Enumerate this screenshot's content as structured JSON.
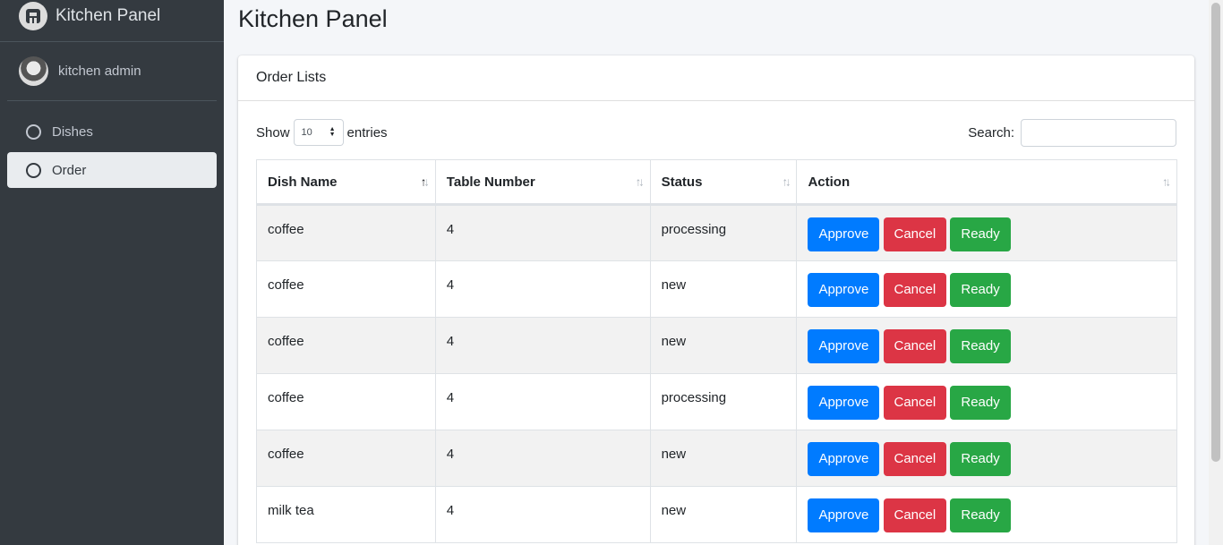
{
  "brand": {
    "title": "Kitchen Panel"
  },
  "user": {
    "name": "kitchen admin"
  },
  "nav": [
    {
      "label": "Dishes",
      "active": false
    },
    {
      "label": "Order",
      "active": true
    }
  ],
  "page": {
    "title": "Kitchen Panel"
  },
  "card": {
    "title": "Order Lists",
    "show_label": "Show",
    "entries_label": "entries",
    "length_value": "10",
    "search_label": "Search:"
  },
  "table": {
    "headers": [
      "Dish Name",
      "Table Number",
      "Status",
      "Action"
    ],
    "actions": {
      "approve": "Approve",
      "cancel": "Cancel",
      "ready": "Ready"
    },
    "rows": [
      {
        "dish": "coffee",
        "table": "4",
        "status": "processing"
      },
      {
        "dish": "coffee",
        "table": "4",
        "status": "new"
      },
      {
        "dish": "coffee",
        "table": "4",
        "status": "new"
      },
      {
        "dish": "coffee",
        "table": "4",
        "status": "processing"
      },
      {
        "dish": "coffee",
        "table": "4",
        "status": "new"
      },
      {
        "dish": "milk tea",
        "table": "4",
        "status": "new"
      }
    ]
  },
  "colors": {
    "sidebar": "#343a40",
    "approve": "#007bff",
    "cancel": "#dc3545",
    "ready": "#28a745"
  }
}
